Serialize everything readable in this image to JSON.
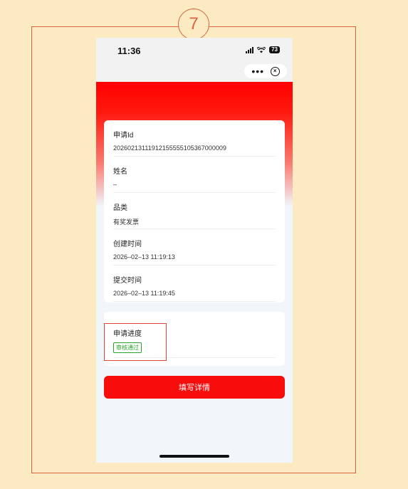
{
  "annotation": {
    "step_number": "7"
  },
  "status_bar": {
    "time": "11:36",
    "battery": "73"
  },
  "nav": {
    "more_icon": "more-dots-icon",
    "close_icon": "close-circle-icon"
  },
  "info_fields": [
    {
      "label": "申请Id",
      "value": "20260213111912155555105367000009"
    },
    {
      "label": "姓名",
      "value": "–"
    },
    {
      "label": "品类",
      "value": "有奖发票"
    },
    {
      "label": "创建时间",
      "value": "2026–02–13 11:19:13"
    },
    {
      "label": "提交时间",
      "value": "2026–02–13 11:19:45"
    }
  ],
  "progress": {
    "label": "申请进度",
    "status": "审核通过"
  },
  "actions": {
    "fill_details_label": "填写详情"
  },
  "colors": {
    "accent_red": "#f80d0d",
    "status_green": "#2aa32a",
    "annotation": "#d9643f"
  }
}
